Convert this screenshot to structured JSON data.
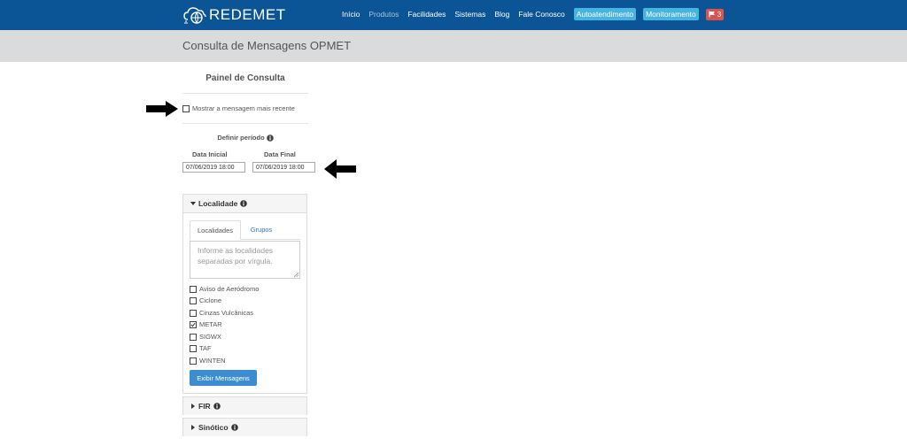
{
  "brand": {
    "name": "REDEMET"
  },
  "nav": {
    "items": [
      "Início",
      "Produtos",
      "Facilidades",
      "Sistemas",
      "Blog",
      "Fale Conosco"
    ],
    "buttons": [
      "Autoatendimento",
      "Monitoramento"
    ],
    "badge_count": "3"
  },
  "page": {
    "title": "Consulta de Mensagens OPMET"
  },
  "panel": {
    "title": "Painel de Consulta",
    "latest_label": "Mostrar a mensagem mais recente",
    "period_label": "Definir período",
    "start_label": "Data Inicial",
    "end_label": "Data Final",
    "start_value": "07/06/2019 18:00",
    "end_value": "07/06/2019 18:00"
  },
  "localidade": {
    "header": "Localidade",
    "tabs": [
      "Localidades",
      "Grupos"
    ],
    "textarea_placeholder": "Informe as localidades separadas por vírgula.",
    "options": [
      {
        "label": "Aviso de Aeródromo",
        "checked": false
      },
      {
        "label": "Ciclone",
        "checked": false
      },
      {
        "label": "Cinzas Vulcânicas",
        "checked": false
      },
      {
        "label": "METAR",
        "checked": true
      },
      {
        "label": "SIGWX",
        "checked": false
      },
      {
        "label": "TAF",
        "checked": false
      },
      {
        "label": "WINTEN",
        "checked": false
      }
    ],
    "submit_label": "Exibir Mensagens"
  },
  "sections": [
    "FIR",
    "Sinótico"
  ],
  "colors": {
    "navbar": "#0b5596",
    "accent": "#47b3e0",
    "badge": "#d9534f",
    "button": "#3c8dd0"
  }
}
